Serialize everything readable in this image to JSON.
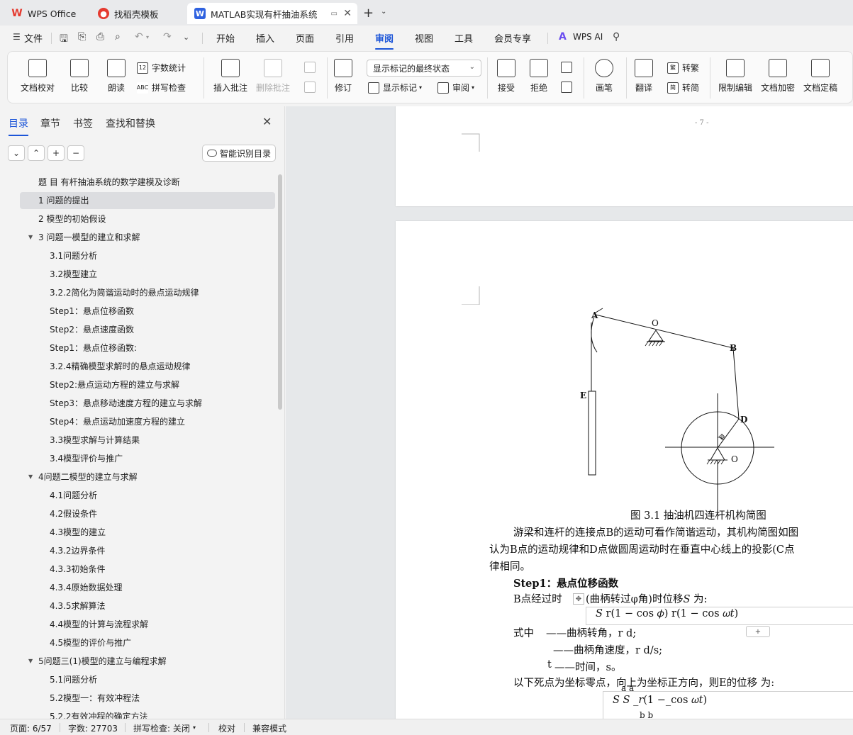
{
  "tabs": [
    {
      "label": "WPS Office"
    },
    {
      "label": "找稻壳模板"
    },
    {
      "label": "MATLAB实现有杆抽油系统的"
    }
  ],
  "menu": {
    "file": "文件",
    "items": [
      "开始",
      "插入",
      "页面",
      "引用",
      "审阅",
      "视图",
      "工具",
      "会员专享"
    ],
    "active": "审阅",
    "ai": "WPS AI"
  },
  "ribbon": {
    "doc_check": "文档校对",
    "compare": "比较",
    "read_aloud": "朗读",
    "word_count": "字数统计",
    "spell_check": "拼写检查",
    "insert_comment": "插入批注",
    "delete_comment": "删除批注",
    "revise": "修订",
    "markup_select": "显示标记的最终状态",
    "show_markup": "显示标记",
    "review": "审阅",
    "accept": "接受",
    "reject": "拒绝",
    "ink": "画笔",
    "translate": "翻译",
    "to_traditional": "转繁",
    "to_simplified": "转简",
    "restrict_edit": "限制编辑",
    "doc_encrypt": "文档加密",
    "doc_finalize": "文档定稿"
  },
  "nav": {
    "tabs": [
      "目录",
      "章节",
      "书签",
      "查找和替换"
    ],
    "smart_toc": "智能识别目录",
    "toc": [
      {
        "label": "题 目 有杆抽油系统的数学建模及诊断",
        "level": 0
      },
      {
        "label": "1 问题的提出",
        "level": 0,
        "selected": true
      },
      {
        "label": "2 模型的初始假设",
        "level": 0
      },
      {
        "label": "3 问题一模型的建立和求解",
        "level": 0,
        "expanded": true
      },
      {
        "label": "3.1问题分析",
        "level": 1
      },
      {
        "label": "3.2模型建立",
        "level": 1
      },
      {
        "label": "3.2.2简化为简谐运动时的悬点运动规律",
        "level": 1
      },
      {
        "label": "Step1：悬点位移函数",
        "level": 1
      },
      {
        "label": "Step2：悬点速度函数",
        "level": 1
      },
      {
        "label": "Step1：悬点位移函数:",
        "level": 1
      },
      {
        "label": "3.2.4精确模型求解时的悬点运动规律",
        "level": 1
      },
      {
        "label": "Step2:悬点运动方程的建立与求解",
        "level": 1
      },
      {
        "label": "Step3：悬点移动速度方程的建立与求解",
        "level": 1
      },
      {
        "label": "Step4：悬点运动加速度方程的建立",
        "level": 1
      },
      {
        "label": "3.3模型求解与计算结果",
        "level": 1
      },
      {
        "label": "3.4模型评价与推广",
        "level": 1
      },
      {
        "label": "4问题二模型的建立与求解",
        "level": 0,
        "expanded": true
      },
      {
        "label": "4.1问题分析",
        "level": 1
      },
      {
        "label": "4.2假设条件",
        "level": 1
      },
      {
        "label": "4.3模型的建立",
        "level": 1
      },
      {
        "label": "4.3.2边界条件",
        "level": 1
      },
      {
        "label": "4.3.3初始条件",
        "level": 1
      },
      {
        "label": "4.3.4原始数据处理",
        "level": 1
      },
      {
        "label": "4.3.5求解算法",
        "level": 1
      },
      {
        "label": "4.4模型的计算与流程求解",
        "level": 1
      },
      {
        "label": "4.5模型的评价与推广",
        "level": 1
      },
      {
        "label": "5问题三(1)模型的建立与编程求解",
        "level": 0,
        "expanded": true
      },
      {
        "label": "5.1问题分析",
        "level": 1
      },
      {
        "label": "5.2模型一：有效冲程法",
        "level": 1
      },
      {
        "label": "5.2.2有效冲程的确定方法",
        "level": 1
      }
    ]
  },
  "document": {
    "page_number": "- 7 -",
    "figure_labels": {
      "A": "A",
      "O_top": "O",
      "B": "B",
      "E": "E",
      "D": "D",
      "phi": "Φ",
      "O_bottom": "O"
    },
    "caption": "图  3.1 抽油机四连杆机构简图",
    "para1_line1": "游梁和连杆的连接点B的运动可看作简谐运动，其机构简图如图",
    "para1_line2": "认为B点的运动规律和D点做圆周运动时在垂直中心线上的投影(C点",
    "para1_line3": "律相同。",
    "step1_heading": "Step1：悬点位移函数",
    "step1_text_a": "B点经过时",
    "step1_text_b": "(曲柄转过φ角)时位移𝑆 为:",
    "formula1": "𝑆 r(1 − cos 𝜙) r(1 − cos 𝜔𝑡)",
    "where_label": "式中",
    "where_line1": "——曲柄转角，r d;",
    "where_line2": "——曲柄角速度，r d/s;",
    "where_t": "t",
    "where_line3": "——时间，s。",
    "para2": "以下死点为坐标零点，向上为坐标正方向，则E的位移     为:",
    "formula2": "𝑆  𝑆 _𝑟(1 −_cos 𝜔𝑡)",
    "formula2_sup": "a          a",
    "formula2_sub": "b        b"
  },
  "status": {
    "page": "页面: 6/57",
    "words": "字数: 27703",
    "spell": "拼写检查: 关闭",
    "proof": "校对",
    "compat": "兼容模式"
  }
}
